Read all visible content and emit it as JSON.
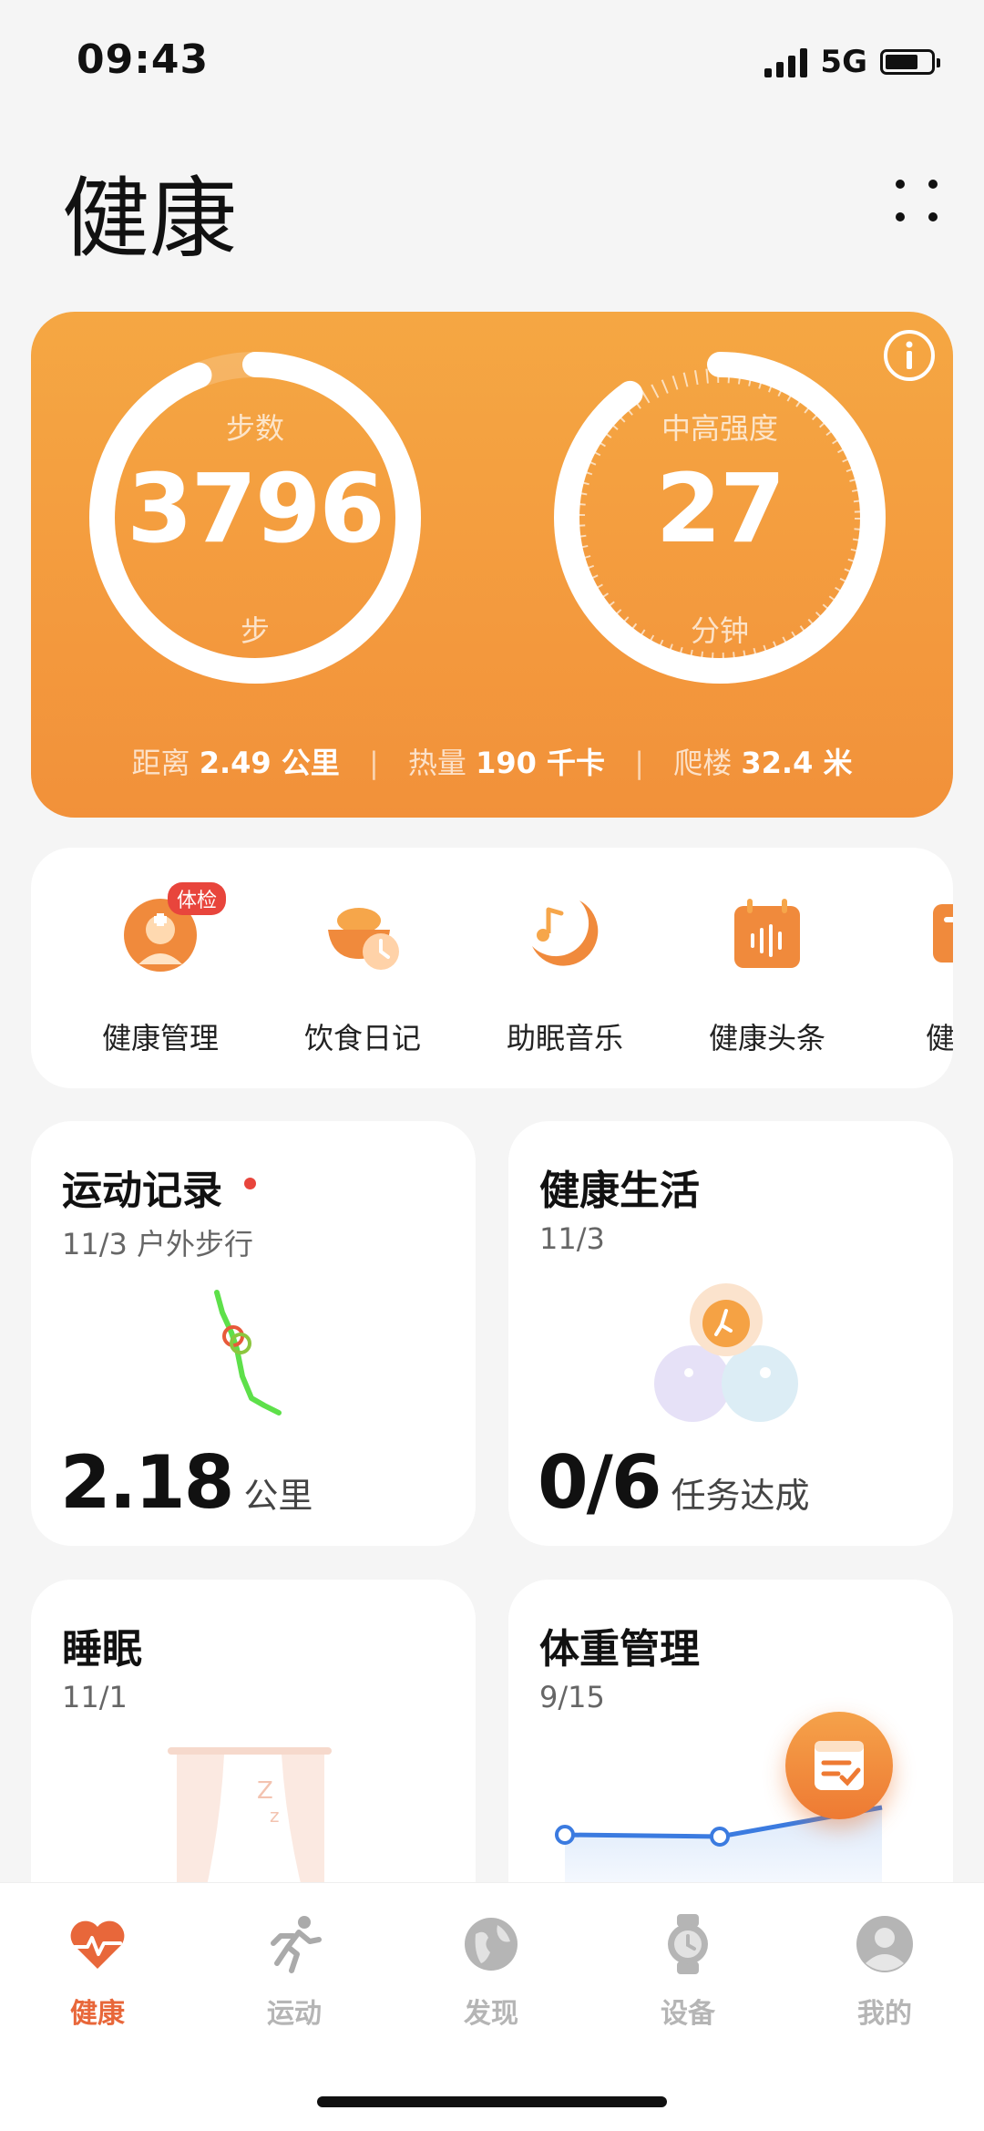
{
  "status_bar": {
    "time": "09:43",
    "network": "5G"
  },
  "header": {
    "title": "健康"
  },
  "activity": {
    "steps": {
      "label": "步数",
      "value": "3796",
      "unit": "步",
      "progress": 0.94
    },
    "intensity": {
      "label": "中高强度",
      "value": "27",
      "unit": "分钟",
      "progress": 0.9
    },
    "summary": {
      "distance_label": "距离",
      "distance_value": "2.49 公里",
      "calories_label": "热量",
      "calories_value": "190 千卡",
      "floors_label": "爬楼",
      "floors_value": "32.4 米"
    }
  },
  "shortcuts": [
    {
      "label": "健康管理",
      "badge": "体检",
      "icon": "doctor-icon"
    },
    {
      "label": "饮食日记",
      "icon": "food-bowl-icon"
    },
    {
      "label": "助眠音乐",
      "icon": "moon-music-icon"
    },
    {
      "label": "健康头条",
      "icon": "audio-calendar-icon"
    },
    {
      "label": "健身好",
      "icon": "fitness-card-icon"
    }
  ],
  "cards": {
    "exercise": {
      "title": "运动记录",
      "sub": "11/3 户外步行",
      "value": "2.18",
      "unit": "公里"
    },
    "life": {
      "title": "健康生活",
      "sub": "11/3",
      "value": "0/6",
      "unit": "任务达成"
    },
    "sleep": {
      "title": "睡眠",
      "sub": "11/1"
    },
    "weight": {
      "title": "体重管理",
      "sub": "9/15"
    }
  },
  "nav": [
    {
      "label": "健康",
      "icon": "heart-pulse-icon",
      "active": true
    },
    {
      "label": "运动",
      "icon": "runner-icon"
    },
    {
      "label": "发现",
      "icon": "globe-icon"
    },
    {
      "label": "设备",
      "icon": "watch-icon"
    },
    {
      "label": "我的",
      "icon": "profile-icon"
    }
  ],
  "colors": {
    "accent": "#f2913a",
    "active_nav": "#e8673a",
    "badge": "#e8453c"
  }
}
